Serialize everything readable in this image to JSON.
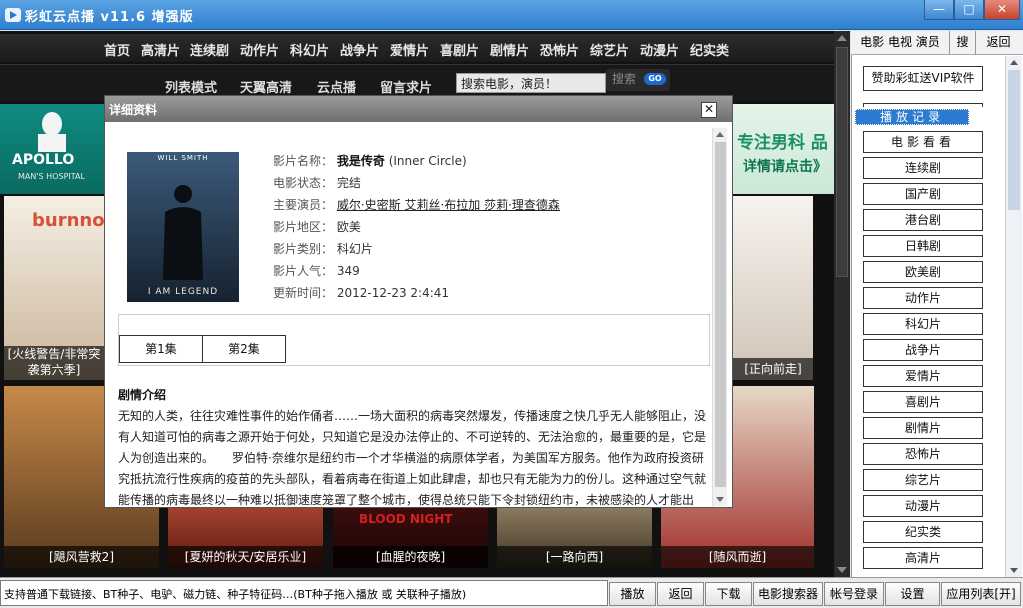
{
  "window": {
    "title": "彩虹云点播 v11.6 增强版",
    "min_glyph": "—",
    "max_glyph": "□",
    "close_glyph": "✕"
  },
  "nav_primary": [
    "首页",
    "高清片",
    "连续剧",
    "动作片",
    "科幻片",
    "战争片",
    "爱情片",
    "喜剧片",
    "剧情片",
    "恐怖片",
    "综艺片",
    "动漫片",
    "纪实类"
  ],
  "nav_secondary": [
    "列表模式",
    "天翼高清",
    "云点播",
    "留言求片"
  ],
  "search": {
    "value": "搜索电影，演员！",
    "button_label": "搜索",
    "go_label": "GO"
  },
  "banners": {
    "left_brand": "APOLLO",
    "left_sub": "MAN'S HOSPITAL",
    "right_line1": "专注男科 品",
    "right_line2": "详情请点击》"
  },
  "posters": [
    {
      "caption": "[火线警告/非常突袭第六季]"
    },
    {
      "caption": "[正向前走]"
    },
    {
      "caption": "[飓风营救2]"
    },
    {
      "caption": "[夏妍的秋天/安居乐业]"
    },
    {
      "caption": "[血腥的夜晚]"
    },
    {
      "caption": "[一路向西]"
    },
    {
      "caption": "[随风而逝]"
    }
  ],
  "modal": {
    "title": "详细资料",
    "close_label": "✕",
    "cover_top": "WILL SMITH",
    "cover_bottom": "I AM LEGEND",
    "fields": {
      "name_label": "影片名称：",
      "name_value": "我是传奇",
      "name_en": "(Inner Circle)",
      "status_label": "电影状态：",
      "status_value": "完结",
      "cast_label": "主要演员：",
      "cast_value": "威尔·史密斯 艾莉丝·布拉加 莎莉·理查德森",
      "region_label": "影片地区：",
      "region_value": "欧美",
      "genre_label": "影片类别：",
      "genre_value": "科幻片",
      "popularity_label": "影片人气：",
      "popularity_value": "349",
      "updated_label": "更新时间：",
      "updated_value": "2012-12-23 2:4:41"
    },
    "episodes": [
      "第1集",
      "第2集"
    ],
    "plot_title": "剧情介绍",
    "plot_text": "无知的人类，往往灾难性事件的始作俑者……一场大面积的病毒突然爆发，传播速度之快几乎无人能够阻止，没有人知道可怕的病毒之源开始于何处，只知道它是没办法停止的、不可逆转的、无法治愈的，最重要的是，它是人为创造出来的。　　罗伯特·奈维尔是纽约市一个才华横溢的病原体学者，为美国军方服务。他作为政府投资研究抵抗流行性疾病的疫苗的先头部队，看着病毒在街道上如此肆虐，却也只有无能为力的份儿。这种通过空气就能传播的病毒最终以一种难以抵御速度笼罩了整个城市，使得总统只能下令封锁纽约市，未被感染的人才能出"
  },
  "right_panel": {
    "tabs": [
      "电影 电视 演员",
      "搜",
      "返回"
    ],
    "vip_button": "赞助彩虹送VIP软件",
    "history_button": "播放记录",
    "watch_button": "电影看看",
    "categories": [
      "连续剧",
      "国产剧",
      "港台剧",
      "日韩剧",
      "欧美剧",
      "动作片",
      "科幻片",
      "战争片",
      "爱情片",
      "喜剧片",
      "剧情片",
      "恐怖片",
      "综艺片",
      "动漫片",
      "纪实类",
      "高清片"
    ]
  },
  "statusbar": {
    "text": "支持普通下载链接、BT种子、电驴、磁力链、种子特征码…(BT种子拖入播放 或 关联种子播放)",
    "buttons": [
      "播放",
      "返回",
      "下载",
      "电影搜索器",
      "帐号登录",
      "设置",
      "应用列表[开]"
    ]
  }
}
